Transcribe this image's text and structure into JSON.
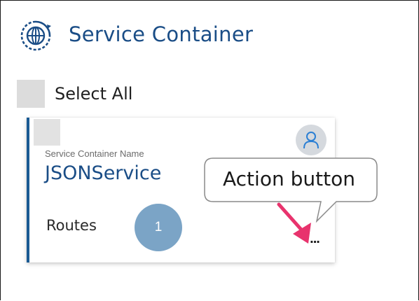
{
  "header": {
    "title": "Service Container",
    "icon": "globe-refresh-icon",
    "color": "#1a4d86"
  },
  "select_all": {
    "label": "Select All"
  },
  "card": {
    "field_label": "Service Container Name",
    "name": "JSONService",
    "routes_label": "Routes",
    "routes_count": "1",
    "action_label": "...",
    "avatar_icon": "user-icon",
    "accent_color": "#1a5a93",
    "badge_color": "#7ba4c6"
  },
  "annotation": {
    "callout_text": "Action button",
    "arrow_color": "#e8336d"
  }
}
